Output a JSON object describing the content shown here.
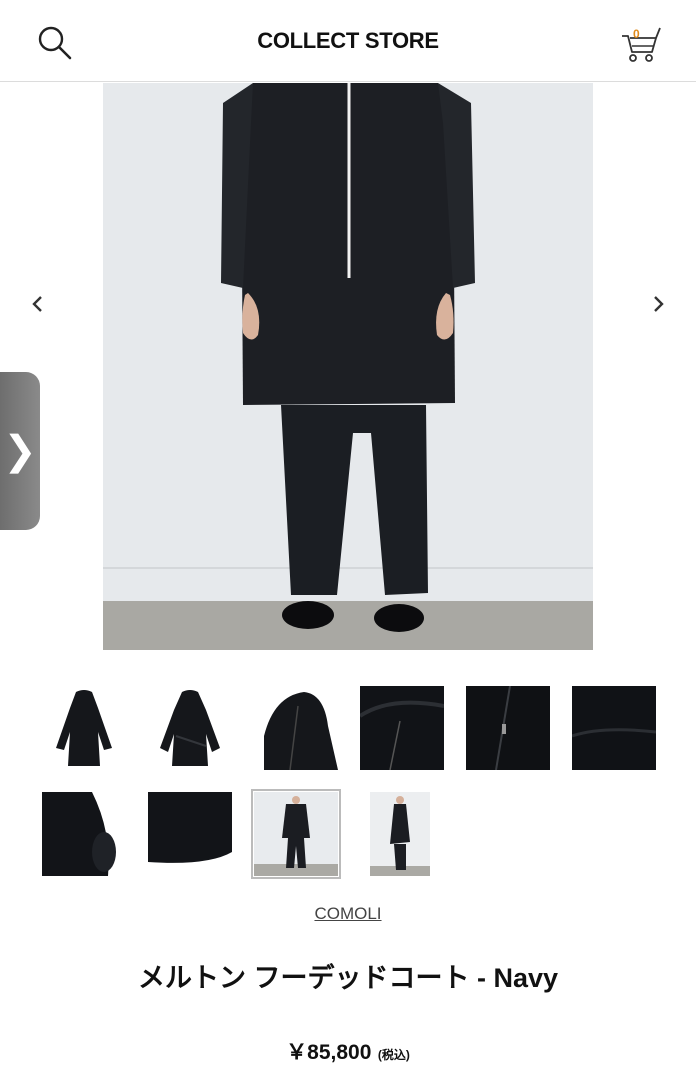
{
  "header": {
    "title": "COLLECT STORE",
    "cart_count": "0",
    "search_icon": "search-icon",
    "cart_icon": "cart-icon"
  },
  "gallery": {
    "prev_icon": "chevron-left-icon",
    "next_icon": "chevron-right-icon",
    "side_tab_glyph": "❯",
    "thumbnails": [
      {
        "name": "thumb-coat-front-flat"
      },
      {
        "name": "thumb-coat-back-flat"
      },
      {
        "name": "thumb-hood-detail"
      },
      {
        "name": "thumb-collar-detail"
      },
      {
        "name": "thumb-zip-detail"
      },
      {
        "name": "thumb-pocket-detail"
      },
      {
        "name": "thumb-sleeve-detail"
      },
      {
        "name": "thumb-hem-detail"
      },
      {
        "name": "thumb-model-front",
        "selected": true
      },
      {
        "name": "thumb-model-side"
      }
    ]
  },
  "product": {
    "brand": "COMOLI",
    "name": "メルトン フーデッドコート - Navy",
    "price": "￥85,800",
    "tax_note": "(税込)"
  },
  "colors": {
    "accent": "#e08a1a",
    "garment": "#1b1d22"
  }
}
